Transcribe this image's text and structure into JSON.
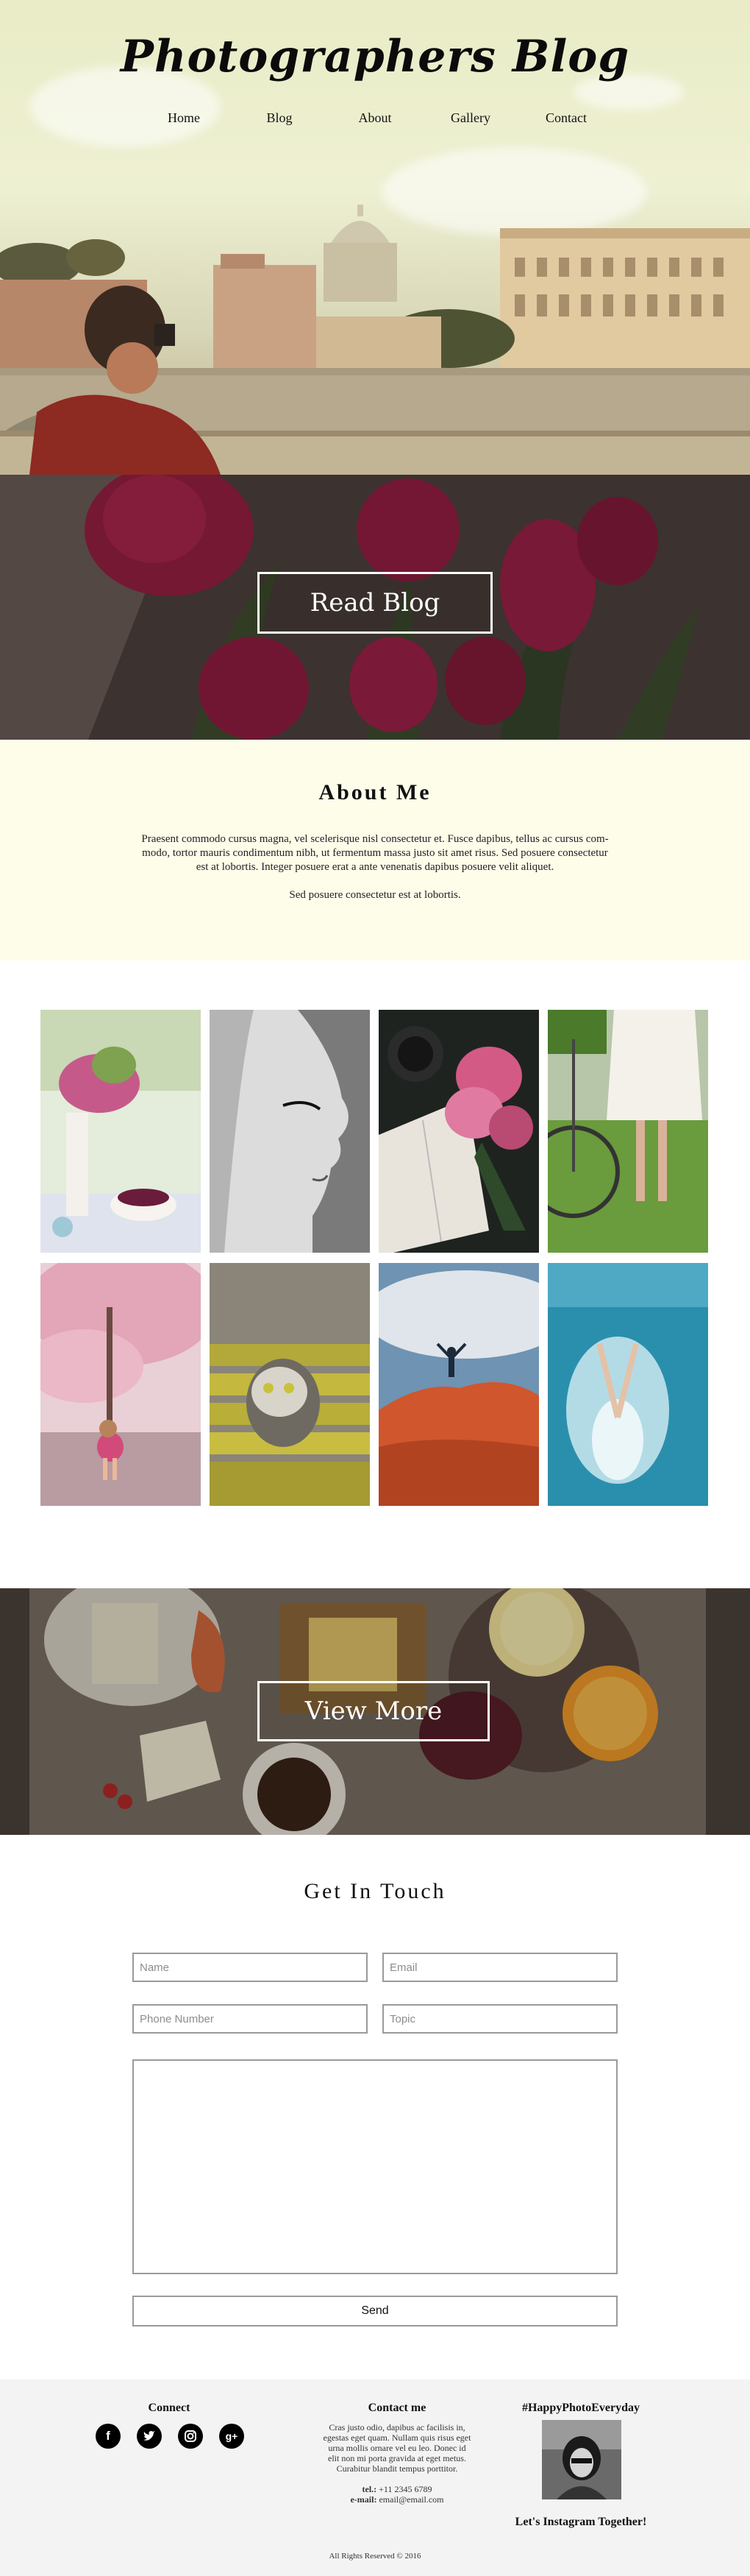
{
  "site": {
    "title": "Photographers Blog"
  },
  "nav": {
    "items": [
      "Home",
      "Blog",
      "About",
      "Gallery",
      "Contact"
    ]
  },
  "banner_blog": {
    "button_label": "Read Blog"
  },
  "about": {
    "heading": "About Me",
    "paragraph1_line1": "Praesent commodo cursus magna, vel scelerisque nisl consectetur et. Fusce dapibus, tellus ac cursus com-",
    "paragraph1_line2": "modo, tortor mauris condimentum nibh, ut fermentum massa justo sit amet risus. Sed posuere consectetur",
    "paragraph1_line3": "est at lobortis. Integer posuere erat a ante venenatis dapibus posuere velit aliquet.",
    "paragraph2": "Sed posuere consectetur est at lobortis."
  },
  "gallery": {
    "photos": [
      "flowers-and-berries",
      "woman-profile",
      "book-and-peonies",
      "bicycle-and-dress",
      "girl-cherry-blossom",
      "cat-on-bench",
      "man-on-rocks",
      "woman-splashing-water"
    ]
  },
  "banner_more": {
    "button_label": "View More"
  },
  "contact": {
    "heading": "Get In Touch",
    "name_placeholder": "Name",
    "email_placeholder": "Email",
    "phone_placeholder": "Phone Number",
    "topic_placeholder": "Topic",
    "message_value": "",
    "send_label": "Send"
  },
  "footer": {
    "connect_title": "Connect",
    "social_icons": [
      "facebook-icon",
      "twitter-icon",
      "instagram-icon",
      "google-plus-icon"
    ],
    "contact_title": "Contact me",
    "contact_line1": "Cras justo odio, dapibus ac facilisis in,",
    "contact_line2": "egestas eget quam. Nullam quis risus eget",
    "contact_line3": "urna mollis ornare vel eu leo. Donec id",
    "contact_line4": "elit non mi porta gravida at eget metus.",
    "contact_line5": "Curabitur blandit tempus porttitor.",
    "tel_label": "tel.:",
    "tel_value": "+11 2345 6789",
    "email_label": "e-mail:",
    "email_value": "email@email.com",
    "hashtag": "#HappyPhotoEveryday",
    "instagram_caption": "Let's Instagram Together!",
    "copyright": "All Rights Reserved © 2016"
  },
  "colors": {
    "about_bg": "#fefdea",
    "footer_bg": "#f3f3f3",
    "field_border": "#9a9a9a"
  }
}
